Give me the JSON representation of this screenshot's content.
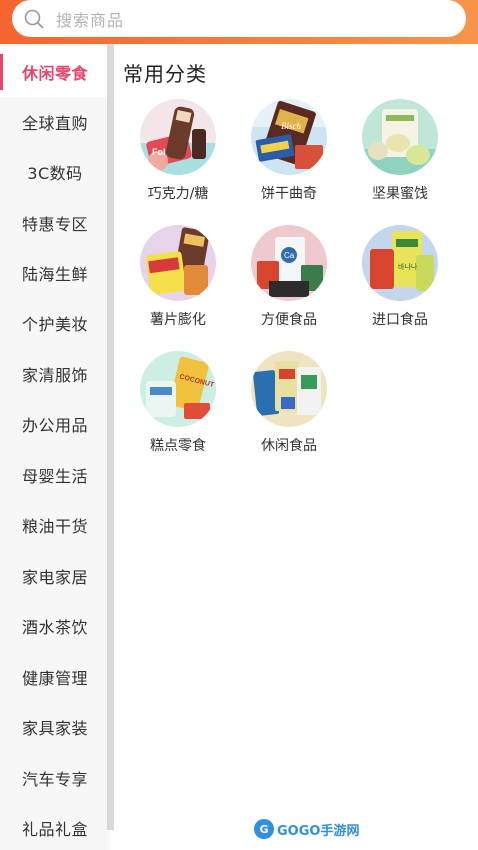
{
  "search": {
    "placeholder": "搜索商品"
  },
  "sidebar": {
    "items": [
      {
        "label": "休闲零食",
        "active": true
      },
      {
        "label": "全球直购"
      },
      {
        "label": "3C数码"
      },
      {
        "label": "特惠专区"
      },
      {
        "label": "陆海生鲜"
      },
      {
        "label": "个护美妆"
      },
      {
        "label": "家清服饰"
      },
      {
        "label": "办公用品"
      },
      {
        "label": "母婴生活"
      },
      {
        "label": "粮油干货"
      },
      {
        "label": "家电家居"
      },
      {
        "label": "酒水茶饮"
      },
      {
        "label": "健康管理"
      },
      {
        "label": "家具家装"
      },
      {
        "label": "汽车专享"
      },
      {
        "label": "礼品礼盒"
      }
    ]
  },
  "main": {
    "section_title": "常用分类",
    "categories": [
      {
        "label": "巧克力/糖",
        "icon": "chocolate-candy-image"
      },
      {
        "label": "饼干曲奇",
        "icon": "biscuit-cookie-image"
      },
      {
        "label": "坚果蜜饯",
        "icon": "nuts-dried-fruit-image"
      },
      {
        "label": "薯片膨化",
        "icon": "potato-chips-image"
      },
      {
        "label": "方便食品",
        "icon": "instant-food-image"
      },
      {
        "label": "进口食品",
        "icon": "imported-food-image"
      },
      {
        "label": "糕点零食",
        "icon": "pastry-snack-image"
      },
      {
        "label": "休闲食品",
        "icon": "leisure-food-image"
      }
    ]
  },
  "watermark": {
    "text": "GOGO手游网",
    "logo_letter": "G"
  },
  "colors": {
    "accent": "#e8466a",
    "topbar": "#f6642f"
  }
}
